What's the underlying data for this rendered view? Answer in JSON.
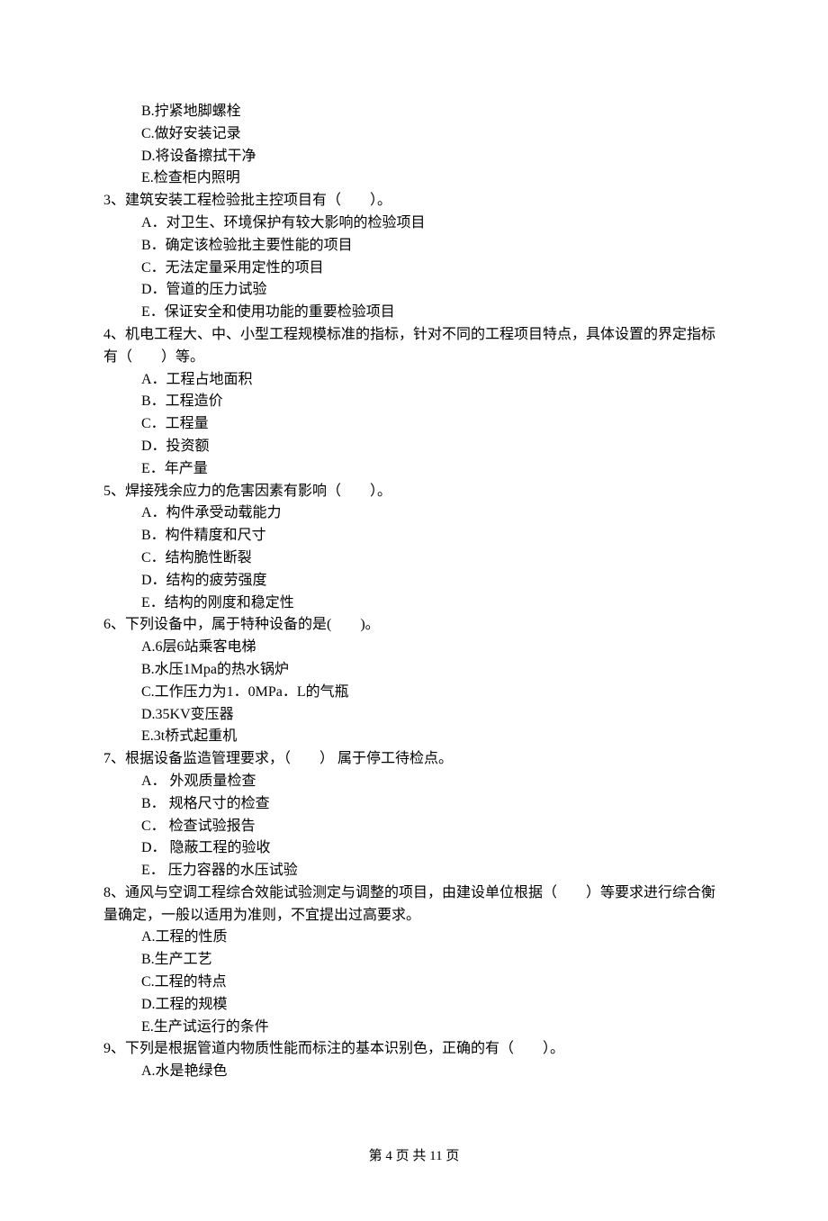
{
  "footer": "第 4 页 共 11 页",
  "leading_options": [
    "B.拧紧地脚螺栓",
    "C.做好安装记录",
    "D.将设备擦拭干净",
    "E.检查柜内照明"
  ],
  "questions": [
    {
      "stem": "3、建筑安装工程检验批主控项目有（　　）。",
      "options": [
        "A．对卫生、环境保护有较大影响的检验项目",
        "B．确定该检验批主要性能的项目",
        "C．无法定量采用定性的项目",
        "D．管道的压力试验",
        "E．保证安全和使用功能的重要检验项目"
      ]
    },
    {
      "stem": "4、机电工程大、中、小型工程规模标准的指标，针对不同的工程项目特点，具体设置的界定指标有（　　）等。",
      "options": [
        "A．工程占地面积",
        "B．工程造价",
        "C．工程量",
        "D．投资额",
        "E．年产量"
      ]
    },
    {
      "stem": "5、焊接残余应力的危害因素有影响（　　）。",
      "options": [
        "A．构件承受动载能力",
        "B．构件精度和尺寸",
        "C．结构脆性断裂",
        "D．结构的疲劳强度",
        "E．结构的刚度和稳定性"
      ]
    },
    {
      "stem": "6、下列设备中，属于特种设备的是(　　)。",
      "options": [
        "A.6层6站乘客电梯",
        "B.水压1Mpa的热水锅炉",
        "C.工作压力为1．0MPa．L的气瓶",
        "D.35KV变压器",
        "E.3t桥式起重机"
      ]
    },
    {
      "stem": "7、根据设备监造管理要求，（　　） 属于停工待检点。",
      "options": [
        "A． 外观质量检查",
        "B． 规格尺寸的检查",
        "C． 检查试验报告",
        "D． 隐蔽工程的验收",
        "E． 压力容器的水压试验"
      ]
    },
    {
      "stem": "8、通风与空调工程综合效能试验测定与调整的项目，由建设单位根据（　　）等要求进行综合衡量确定，一般以适用为准则，不宜提出过高要求。",
      "options": [
        "A.工程的性质",
        "B.生产工艺",
        "C.工程的特点",
        "D.工程的规模",
        "E.生产试运行的条件"
      ]
    },
    {
      "stem": "9、下列是根据管道内物质性能而标注的基本识别色，正确的有（　　）。",
      "options": [
        "A.水是艳绿色"
      ]
    }
  ]
}
